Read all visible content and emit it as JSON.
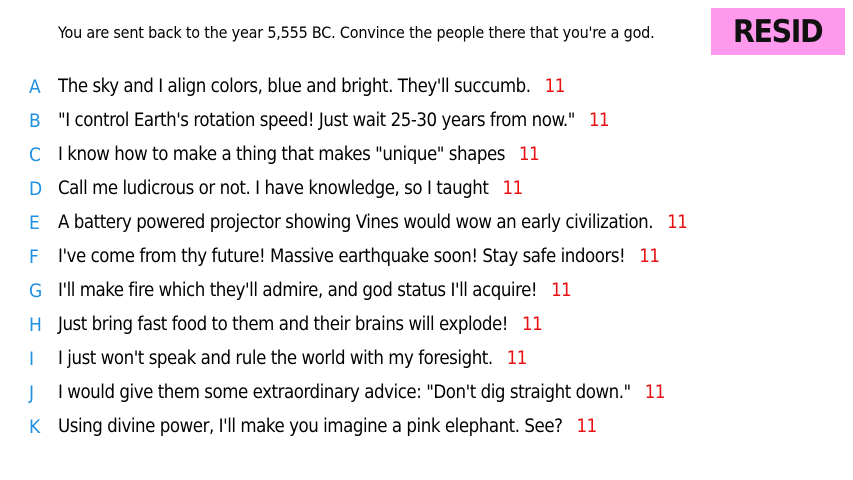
{
  "prompt": "You are sent back to the year 5,555 BC. Convince the people there that you're a god.",
  "badge": {
    "label": "RESID",
    "color": "#ff99ee"
  },
  "colors": {
    "letter": "#1e8fe1",
    "score": "#e81010"
  },
  "answers": [
    {
      "letter": "A",
      "text": "The sky and I align colors, blue and bright. They'll succumb.",
      "score": "11"
    },
    {
      "letter": "B",
      "text": "\"I control Earth's rotation speed! Just wait 25-30 years from now.\"",
      "score": "11"
    },
    {
      "letter": "C",
      "text": "I know how to make a thing that makes \"unique\" shapes",
      "score": "11"
    },
    {
      "letter": "D",
      "text": "Call me ludicrous or not. I have knowledge, so I taught",
      "score": "11"
    },
    {
      "letter": "E",
      "text": "A battery powered projector showing Vines would wow an early civilization.",
      "score": "11"
    },
    {
      "letter": "F",
      "text": "I've come from thy future! Massive earthquake soon! Stay safe indoors!",
      "score": "11"
    },
    {
      "letter": "G",
      "text": "I'll make fire which they'll admire, and god status I'll acquire!",
      "score": "11"
    },
    {
      "letter": "H",
      "text": "Just bring fast food to them and their brains will explode!",
      "score": "11"
    },
    {
      "letter": "I",
      "text": "I just won't speak and rule the world with my foresight.",
      "score": "11"
    },
    {
      "letter": "J",
      "text": "I would give them some extraordinary advice: \"Don't dig straight down.\"",
      "score": "11"
    },
    {
      "letter": "K",
      "text": "Using divine power, I'll make you imagine a pink elephant. See?",
      "score": "11"
    }
  ]
}
